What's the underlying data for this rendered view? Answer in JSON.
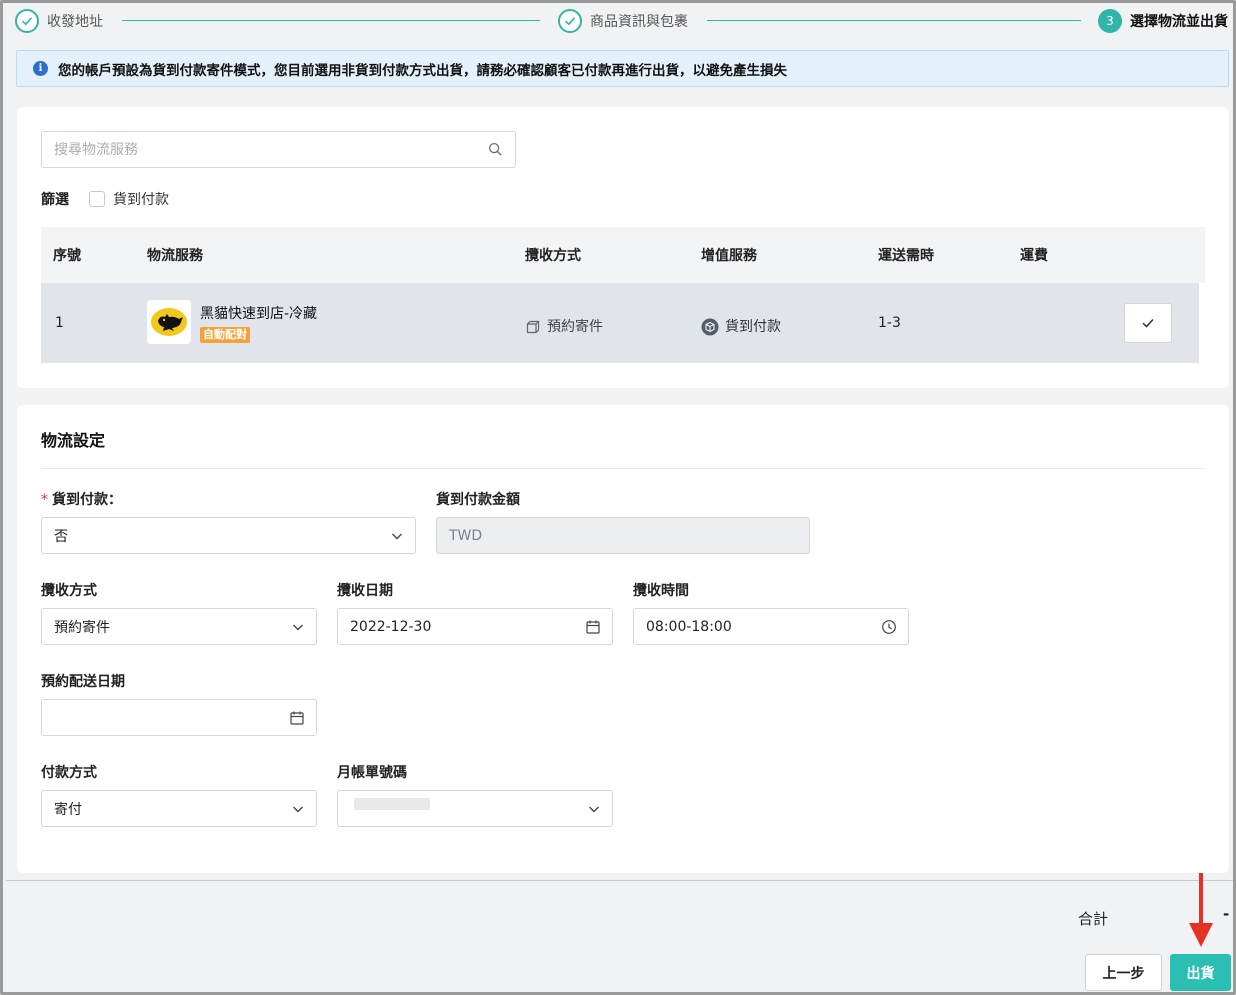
{
  "stepper": {
    "steps": [
      {
        "label": "收發地址",
        "state": "done"
      },
      {
        "label": "商品資訊與包裹",
        "state": "done"
      },
      {
        "label": "選擇物流並出貨",
        "state": "active",
        "number": "3"
      }
    ]
  },
  "alert": {
    "icon": "info-icon",
    "text": "您的帳戶預設為貨到付款寄件模式，您目前選用非貨到付款方式出貨，請務必確認顧客已付款再進行出貨，以避免產生損失"
  },
  "service_search": {
    "placeholder": "搜尋物流服務",
    "value": ""
  },
  "filter": {
    "label": "篩選",
    "options": [
      {
        "label": "貨到付款",
        "checked": false
      }
    ]
  },
  "table": {
    "headers": [
      "序號",
      "物流服務",
      "攬收方式",
      "增值服務",
      "運送需時",
      "運費"
    ],
    "rows": [
      {
        "index": "1",
        "service_name": "黑貓快速到店-冷藏",
        "badge": "自動配對",
        "pickup_method": "預約寄件",
        "value_added": "貨到付款",
        "delivery_time": "1-3",
        "fee": "",
        "selected": true
      }
    ]
  },
  "settings": {
    "title": "物流設定",
    "cod": {
      "label": "貨到付款：",
      "value": "否",
      "required": true
    },
    "cod_amount": {
      "label": "貨到付款金額",
      "placeholder": "TWD",
      "value": ""
    },
    "pickup_method": {
      "label": "攬收方式",
      "value": "預約寄件"
    },
    "pickup_date": {
      "label": "攬收日期",
      "value": "2022-12-30"
    },
    "pickup_time": {
      "label": "攬收時間",
      "value": "08:00-18:00"
    },
    "delivery_date": {
      "label": "預約配送日期",
      "value": ""
    },
    "payment_method": {
      "label": "付款方式",
      "value": "寄付"
    },
    "monthly_account": {
      "label": "月帳單號碼",
      "value": ""
    }
  },
  "footer": {
    "total_label": "合計",
    "total_value": "-",
    "back_label": "上一步",
    "ship_label": "出貨"
  },
  "colors": {
    "accent": "#2bbfb3",
    "badge": "#f5a135",
    "info": "#2a6fd0",
    "annotation_arrow": "#e53224"
  }
}
